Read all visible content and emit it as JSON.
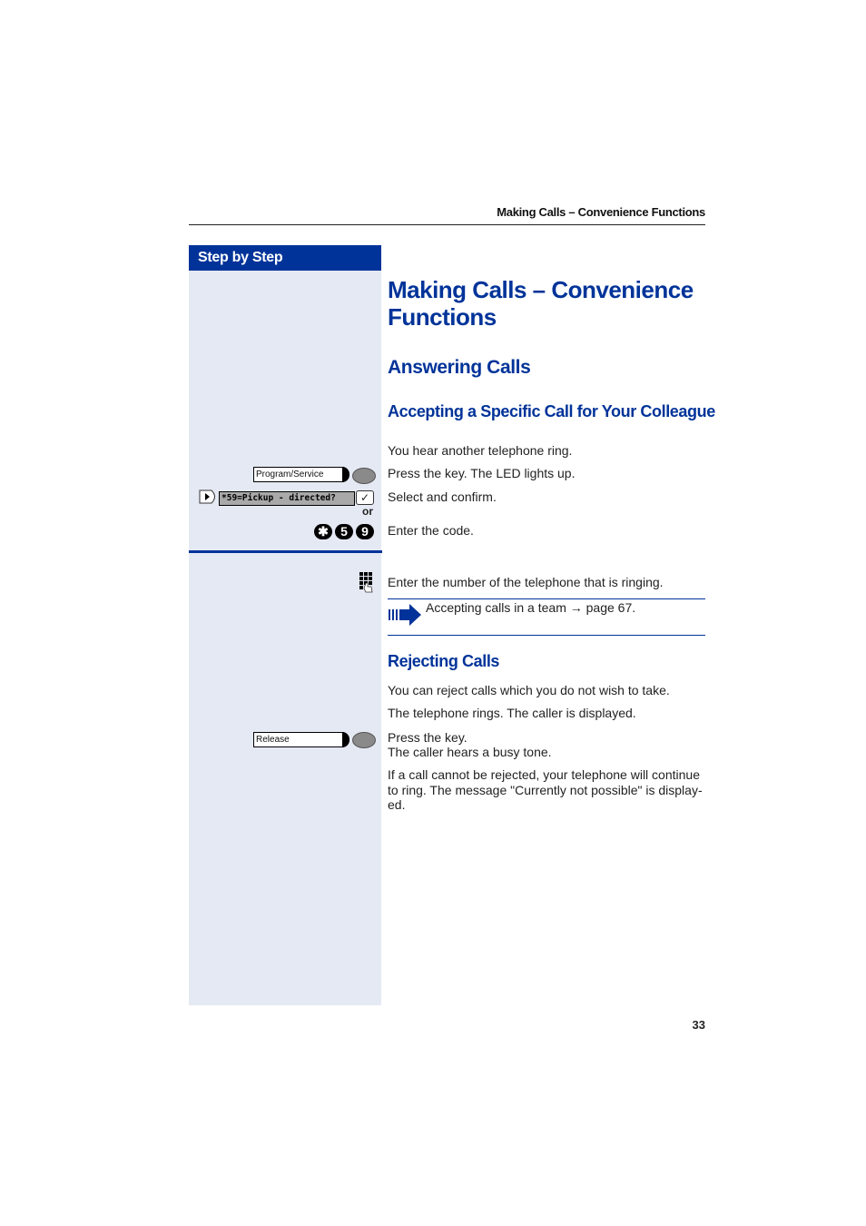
{
  "running_head": "Making Calls – Convenience Functions",
  "sidebar": {
    "title": "Step by Step",
    "program_key_label": "Program/Service",
    "display_text": "*59=Pickup - directed?",
    "confirm_glyph": "✓",
    "or_label": "or",
    "dial_keys": [
      "✱",
      "5",
      "9"
    ],
    "release_key_label": "Release"
  },
  "main": {
    "title": "Making Calls – Convenience Functions",
    "section_answering": "Answering Calls",
    "subsection_accepting": "Accepting a Specific Call for Your Colleague",
    "steps_accepting": [
      "You hear another telephone ring.",
      "Press the key. The LED lights up.",
      "Select and confirm.",
      "Enter the code.",
      "Enter the number of the telephone that is ringing."
    ],
    "note": {
      "text": "Accepting calls in a team → page 67.",
      "icon": "arrow-note-icon"
    },
    "subsection_rejecting": "Rejecting Calls",
    "steps_rejecting": [
      "You can reject calls which you do not wish to take.",
      "The telephone rings. The caller is displayed.",
      "Press the key.",
      "The caller hears a busy tone.",
      "If a call cannot be rejected, your telephone will continue to ring. The message \"Currently not possible\" is display-ed."
    ]
  },
  "footer": {
    "page_number": "33"
  }
}
